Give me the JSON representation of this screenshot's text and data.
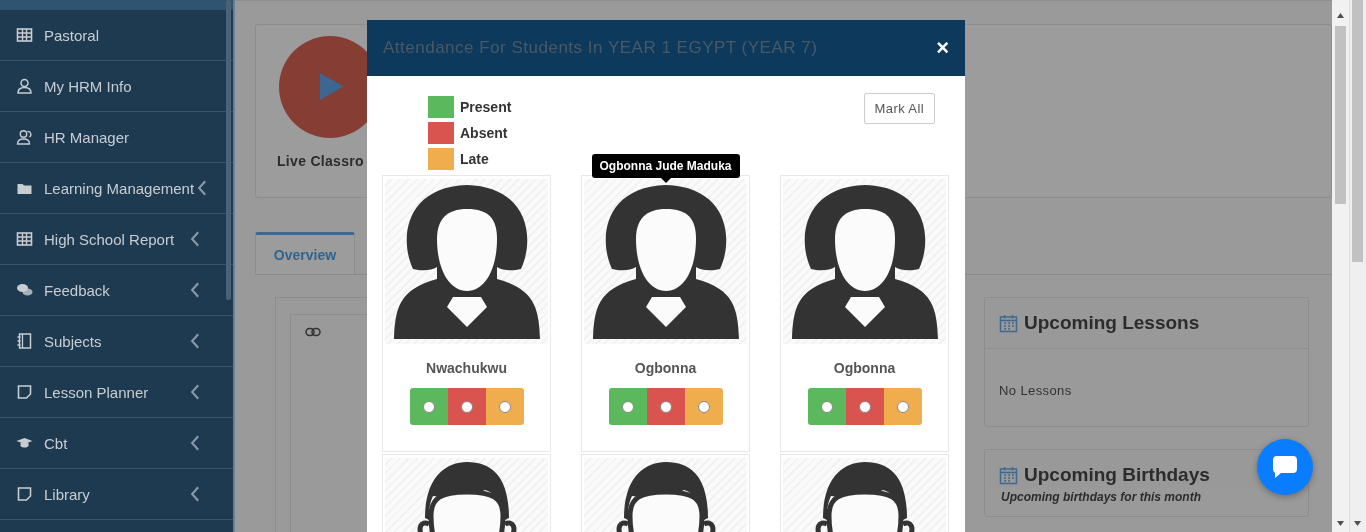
{
  "sidebar": {
    "items": [
      {
        "label": "Pastoral",
        "expandable": false
      },
      {
        "label": "My HRM Info",
        "expandable": false
      },
      {
        "label": "HR Manager",
        "expandable": false
      },
      {
        "label": "Learning Management",
        "expandable": true
      },
      {
        "label": "High School Report",
        "expandable": true
      },
      {
        "label": "Feedback",
        "expandable": true
      },
      {
        "label": "Subjects",
        "expandable": true
      },
      {
        "label": "Lesson Planner",
        "expandable": true
      },
      {
        "label": "Cbt",
        "expandable": true
      },
      {
        "label": "Library",
        "expandable": true
      }
    ]
  },
  "live_card": {
    "label": "Live Classro"
  },
  "tabs": [
    {
      "label": "Overview",
      "selected": true
    }
  ],
  "upcoming_lessons": {
    "title": "Upcoming Lessons",
    "empty_text": "No Lessons"
  },
  "upcoming_birthdays": {
    "title": "Upcoming Birthdays",
    "subtitle": "Upcoming birthdays for this month"
  },
  "modal": {
    "title": "Attendance For Students In YEAR 1 EGYPT (YEAR 7)",
    "close": "×",
    "legend": [
      {
        "label": "Present",
        "color": "#5cb85c"
      },
      {
        "label": "Absent",
        "color": "#d9534f"
      },
      {
        "label": "Late",
        "color": "#f0ad4e"
      }
    ],
    "mark_all": "Mark All",
    "students": [
      {
        "name": "Nwachukwu",
        "options": [
          {
            "color": "#5cb85c",
            "selected": false
          },
          {
            "color": "#d9534f",
            "selected": false
          },
          {
            "color": "#f0ad4e",
            "selected": false
          }
        ]
      },
      {
        "name": "Ogbonna",
        "tooltip": "Ogbonna Jude Maduka",
        "options": [
          {
            "color": "#5cb85c",
            "selected": false
          },
          {
            "color": "#d9534f",
            "selected": false
          },
          {
            "color": "#f0ad4e",
            "selected": false
          }
        ]
      },
      {
        "name": "Ogbonna",
        "options": [
          {
            "color": "#5cb85c",
            "selected": false
          },
          {
            "color": "#d9534f",
            "selected": false
          },
          {
            "color": "#f0ad4e",
            "selected": false
          }
        ]
      },
      {
        "kind": "picture"
      },
      {
        "kind": "picture"
      },
      {
        "kind": "picture"
      }
    ]
  }
}
